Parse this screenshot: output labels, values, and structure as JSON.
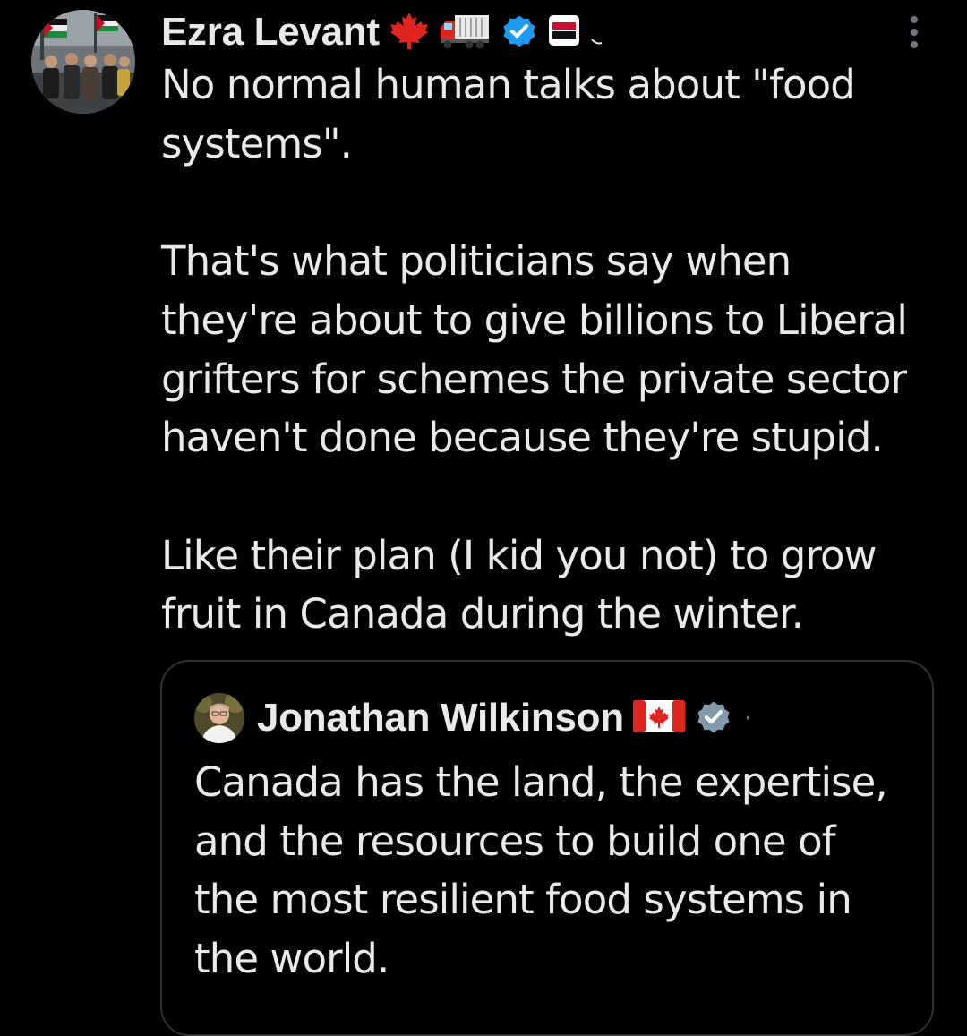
{
  "post": {
    "author": {
      "display_name": "Ezra Levant",
      "name_icons": [
        "maple-leaf-icon",
        "truck-icon",
        "verified-badge-icon",
        "rebel-news-logo-icon"
      ],
      "verified_color": "#1d9bf0"
    },
    "text_paragraphs": [
      "No normal human talks about \"food\nsystems\".",
      "That's what politicians say when\nthey're about to give billions to Liberal\ngrifters for schemes the private sector\nhaven't done because they're stupid.",
      "Like their plan (I kid you not) to grow\nfruit in Canada during the winter."
    ],
    "more_menu_icon": "more-vertical-icon"
  },
  "quoted_post": {
    "author": {
      "display_name": "Jonathan Wilkinson",
      "name_icons": [
        "canada-flag-icon",
        "government-badge-icon"
      ],
      "badge_color": "#829aab"
    },
    "separator": "·",
    "text": "Canada has the land, the expertise,\nand the resources to build one of\nthe most resilient food systems in\nthe world."
  },
  "colors": {
    "background": "#000000",
    "text_primary": "#e7e9ea",
    "text_secondary": "#71767b",
    "border": "#2f3336"
  }
}
